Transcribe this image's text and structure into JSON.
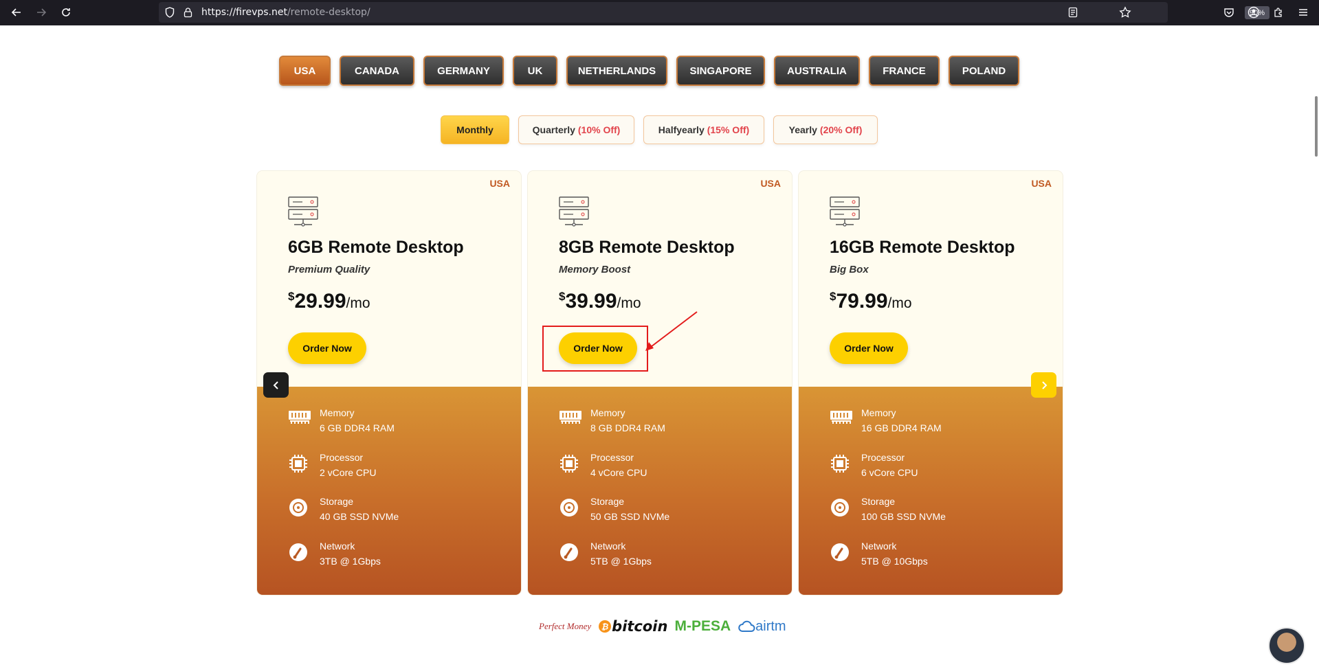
{
  "browser": {
    "url_host": "https://firevps.net",
    "url_path": "/remote-desktop/",
    "zoom": "90%"
  },
  "countries": [
    {
      "label": "USA",
      "active": true
    },
    {
      "label": "CANADA",
      "active": false
    },
    {
      "label": "GERMANY",
      "active": false
    },
    {
      "label": "UK",
      "active": false
    },
    {
      "label": "NETHERLANDS",
      "active": false
    },
    {
      "label": "SINGAPORE",
      "active": false
    },
    {
      "label": "AUSTRALIA",
      "active": false
    },
    {
      "label": "FRANCE",
      "active": false
    },
    {
      "label": "POLAND",
      "active": false
    }
  ],
  "periods": [
    {
      "label": "Monthly",
      "discount": "",
      "active": true
    },
    {
      "label": "Quarterly",
      "discount": "(10% Off)",
      "active": false
    },
    {
      "label": "Halfyearly",
      "discount": "(15% Off)",
      "active": false
    },
    {
      "label": "Yearly",
      "discount": "(20% Off)",
      "active": false
    }
  ],
  "plans": [
    {
      "badge": "USA",
      "title": "6GB Remote Desktop",
      "subtitle": "Premium Quality",
      "currency": "$",
      "price": "29.99",
      "per": "/mo",
      "order_label": "Order Now",
      "specs": [
        {
          "label": "Memory",
          "value": "6 GB DDR4 RAM"
        },
        {
          "label": "Processor",
          "value": "2 vCore CPU"
        },
        {
          "label": "Storage",
          "value": "40 GB SSD NVMe"
        },
        {
          "label": "Network",
          "value": "3TB @ 1Gbps"
        }
      ]
    },
    {
      "badge": "USA",
      "title": "8GB Remote Desktop",
      "subtitle": "Memory Boost",
      "currency": "$",
      "price": "39.99",
      "per": "/mo",
      "order_label": "Order Now",
      "specs": [
        {
          "label": "Memory",
          "value": "8 GB DDR4 RAM"
        },
        {
          "label": "Processor",
          "value": "4 vCore CPU"
        },
        {
          "label": "Storage",
          "value": "50 GB SSD NVMe"
        },
        {
          "label": "Network",
          "value": "5TB @ 1Gbps"
        }
      ]
    },
    {
      "badge": "USA",
      "title": "16GB Remote Desktop",
      "subtitle": "Big Box",
      "currency": "$",
      "price": "79.99",
      "per": "/mo",
      "order_label": "Order Now",
      "specs": [
        {
          "label": "Memory",
          "value": "16 GB DDR4 RAM"
        },
        {
          "label": "Processor",
          "value": "6 vCore CPU"
        },
        {
          "label": "Storage",
          "value": "100 GB SSD NVMe"
        },
        {
          "label": "Network",
          "value": "5TB @ 10Gbps"
        }
      ]
    }
  ],
  "payments": {
    "perfect_money": "Perfect Money",
    "bitcoin": "bitcoin",
    "mpesa": "M-PESA",
    "airtm": "airtm"
  },
  "icons": {
    "back": "arrow-left-icon",
    "forward": "arrow-right-icon",
    "reload": "reload-icon",
    "shield": "shield-icon",
    "lock": "lock-icon",
    "reader": "reader-view-icon",
    "bookmark": "star-icon",
    "pocket": "pocket-icon",
    "account": "account-icon",
    "extensions": "puzzle-icon",
    "menu": "hamburger-icon"
  },
  "colors": {
    "accent_yellow": "#fdd000",
    "accent_orange": "#c86e2a",
    "discount_red": "#e2434b",
    "badge_orange": "#c15a23"
  }
}
